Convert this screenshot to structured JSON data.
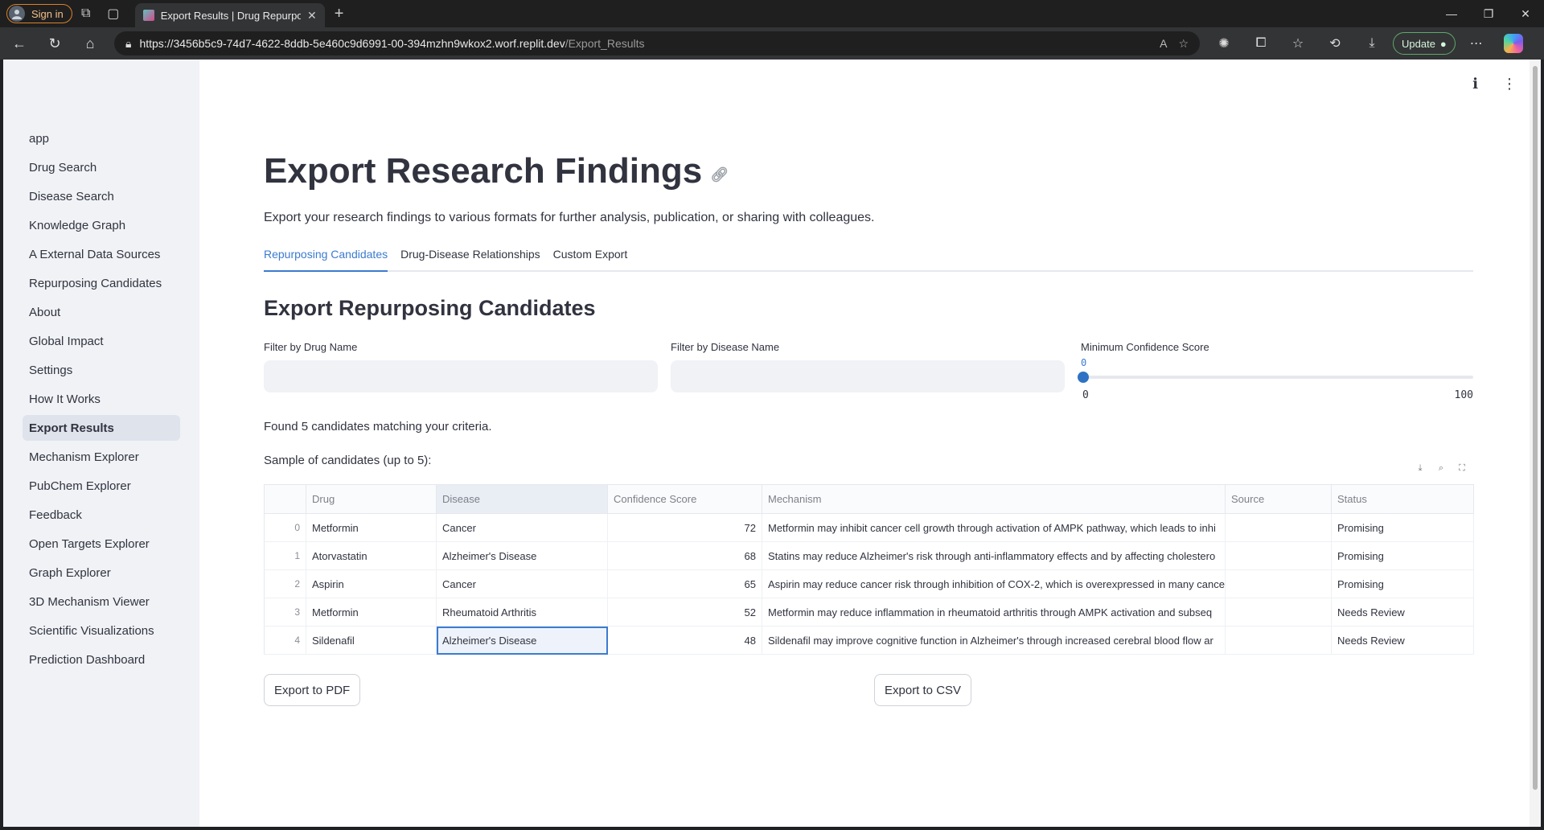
{
  "browser": {
    "signin_label": "Sign in",
    "tab_title": "Export Results | Drug Repurposing",
    "url_main": "https://3456b5c9-74d7-4622-8ddb-5e460c9d6991-00-394mzhn9wkox2.worf.replit.dev",
    "url_path": "/Export_Results",
    "update_label": "Update"
  },
  "sidebar": {
    "items": [
      {
        "label": "app"
      },
      {
        "label": "Drug Search"
      },
      {
        "label": "Disease Search"
      },
      {
        "label": "Knowledge Graph"
      },
      {
        "label": "A External Data Sources"
      },
      {
        "label": "Repurposing Candidates"
      },
      {
        "label": "About"
      },
      {
        "label": "Global Impact"
      },
      {
        "label": "Settings"
      },
      {
        "label": "How It Works"
      },
      {
        "label": "Export Results",
        "active": true
      },
      {
        "label": "Mechanism Explorer"
      },
      {
        "label": "PubChem Explorer"
      },
      {
        "label": "Feedback"
      },
      {
        "label": "Open Targets Explorer"
      },
      {
        "label": "Graph Explorer"
      },
      {
        "label": "3D Mechanism Viewer"
      },
      {
        "label": "Scientific Visualizations"
      },
      {
        "label": "Prediction Dashboard"
      }
    ]
  },
  "main": {
    "title": "Export Research Findings",
    "subtitle": "Export your research findings to various formats for further analysis, publication, or sharing with colleagues.",
    "tabs": [
      {
        "label": "Repurposing Candidates",
        "active": true
      },
      {
        "label": "Drug-Disease Relationships"
      },
      {
        "label": "Custom Export"
      }
    ],
    "section_title": "Export Repurposing Candidates",
    "filters": {
      "drug_label": "Filter by Drug Name",
      "drug_value": "",
      "disease_label": "Filter by Disease Name",
      "disease_value": "",
      "confidence_label": "Minimum Confidence Score",
      "confidence_value": "0",
      "confidence_min": "0",
      "confidence_max": "100"
    },
    "found_text": "Found 5 candidates matching your criteria.",
    "sample_text": "Sample of candidates (up to 5):",
    "table": {
      "columns": [
        "",
        "Drug",
        "Disease",
        "Confidence Score",
        "Mechanism",
        "Source",
        "Status"
      ],
      "rows": [
        [
          "0",
          "Metformin",
          "Cancer",
          "72",
          "Metformin may inhibit cancer cell growth through activation of AMPK pathway, which leads to inhi",
          "",
          "Promising"
        ],
        [
          "1",
          "Atorvastatin",
          "Alzheimer's Disease",
          "68",
          "Statins may reduce Alzheimer's risk through anti-inflammatory effects and by affecting cholestero",
          "",
          "Promising"
        ],
        [
          "2",
          "Aspirin",
          "Cancer",
          "65",
          "Aspirin may reduce cancer risk through inhibition of COX-2, which is overexpressed in many cance",
          "",
          "Promising"
        ],
        [
          "3",
          "Metformin",
          "Rheumatoid Arthritis",
          "52",
          "Metformin may reduce inflammation in rheumatoid arthritis through AMPK activation and subseq",
          "",
          "Needs Review"
        ],
        [
          "4",
          "Sildenafil",
          "Alzheimer's Disease",
          "48",
          "Sildenafil may improve cognitive function in Alzheimer's through increased cerebral blood flow ar",
          "",
          "Needs Review"
        ]
      ]
    },
    "export_pdf_label": "Export to PDF",
    "export_csv_label": "Export to CSV"
  }
}
